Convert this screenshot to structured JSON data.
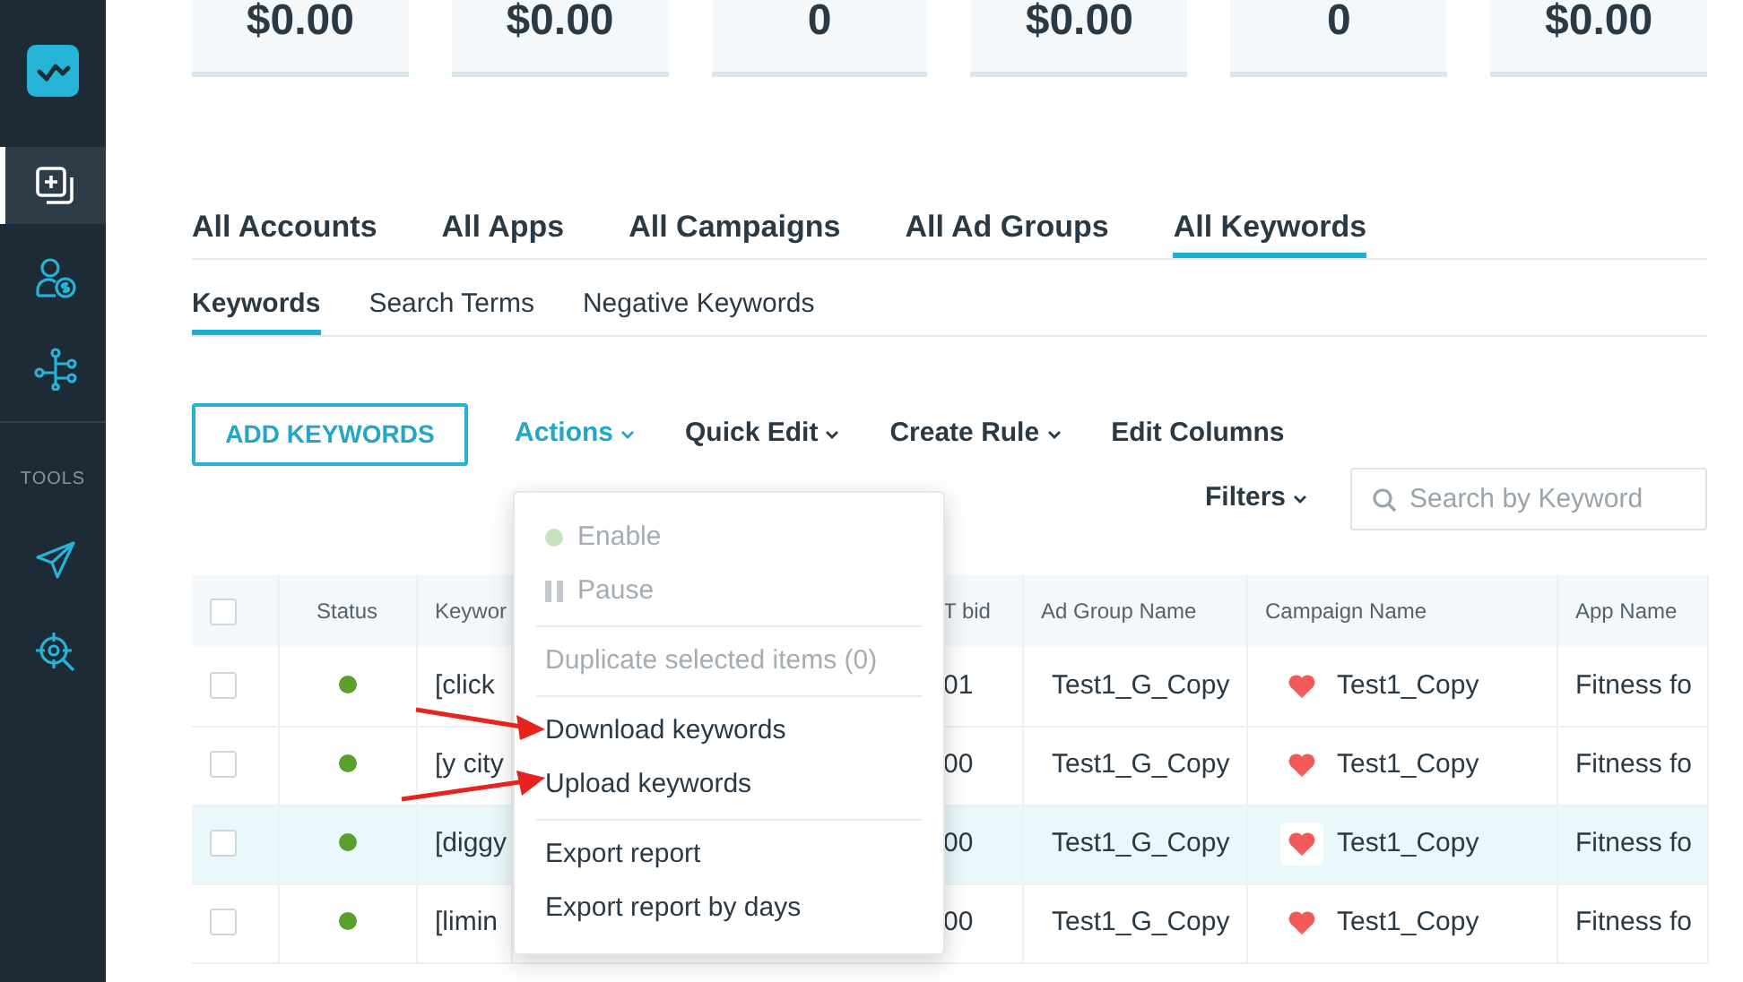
{
  "sidebar": {
    "top_items": [
      {
        "kind": "add-copy",
        "selected": true
      },
      {
        "kind": "user-money",
        "selected": false
      },
      {
        "kind": "branches",
        "selected": false
      }
    ],
    "section_label": "TOOLS",
    "tool_items": [
      {
        "kind": "send",
        "selected": false
      },
      {
        "kind": "target",
        "selected": false
      }
    ]
  },
  "stats": [
    {
      "value": "$0.00"
    },
    {
      "value": "$0.00"
    },
    {
      "value": "0"
    },
    {
      "value": "$0.00"
    },
    {
      "value": "0"
    },
    {
      "value": "$0.00"
    }
  ],
  "level_tabs": [
    {
      "label": "All Accounts",
      "selected": false
    },
    {
      "label": "All Apps",
      "selected": false
    },
    {
      "label": "All Campaigns",
      "selected": false
    },
    {
      "label": "All Ad Groups",
      "selected": false
    },
    {
      "label": "All Keywords",
      "selected": true
    }
  ],
  "sub_tabs": [
    {
      "label": "Keywords",
      "selected": true
    },
    {
      "label": "Search Terms",
      "selected": false
    },
    {
      "label": "Negative Keywords",
      "selected": false
    }
  ],
  "toolbar": {
    "add_button": "ADD KEYWORDS",
    "items": [
      {
        "kind": "dropdown",
        "label": "Actions",
        "open": true
      },
      {
        "kind": "dropdown",
        "label": "Quick Edit",
        "open": false
      },
      {
        "kind": "dropdown",
        "label": "Create Rule",
        "open": false
      },
      {
        "kind": "link",
        "label": "Edit Columns",
        "open": false
      }
    ],
    "filters": "Filters",
    "search": {
      "placeholder": "Search by Keyword"
    }
  },
  "actions_menu": [
    {
      "kind": "dot-item",
      "label": "Enable",
      "disabled": true
    },
    {
      "kind": "pause-item",
      "label": "Pause",
      "disabled": true
    },
    {
      "kind": "divider"
    },
    {
      "kind": "item",
      "label": "Duplicate selected items (0)",
      "disabled": true
    },
    {
      "kind": "divider"
    },
    {
      "kind": "item",
      "label": "Download keywords",
      "disabled": false
    },
    {
      "kind": "item",
      "label": "Upload keywords",
      "disabled": false
    },
    {
      "kind": "divider"
    },
    {
      "kind": "item",
      "label": "Export report",
      "disabled": false
    },
    {
      "kind": "item",
      "label": "Export report by days",
      "disabled": false
    }
  ],
  "annotations": [
    {
      "kind": "arrow"
    },
    {
      "kind": "arrow"
    }
  ],
  "table": {
    "header_checked": false,
    "columns": [
      "Status",
      "Keywor",
      "T bid",
      "Ad Group Name",
      "Campaign Name",
      "App Name"
    ],
    "rows": [
      {
        "checked": false,
        "active": true,
        "keyword": "[click",
        "bid": "01",
        "ad_group": "Test1_G_Copy",
        "campaign": "Test1_Copy",
        "app": "Fitness fo",
        "selected": false
      },
      {
        "checked": false,
        "active": true,
        "keyword": "[y city",
        "bid": "00",
        "ad_group": "Test1_G_Copy",
        "campaign": "Test1_Copy",
        "app": "Fitness fo",
        "selected": false
      },
      {
        "checked": false,
        "active": true,
        "keyword": "[diggy",
        "bid": "00",
        "ad_group": "Test1_G_Copy",
        "campaign": "Test1_Copy",
        "app": "Fitness fo",
        "selected": true
      },
      {
        "checked": false,
        "active": true,
        "keyword": "[limin",
        "bid": "00",
        "ad_group": "Test1_G_Copy",
        "campaign": "Test1_Copy",
        "app": "Fitness fo",
        "selected": false
      }
    ]
  }
}
